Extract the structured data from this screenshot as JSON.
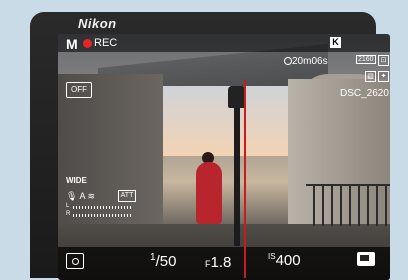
{
  "brand": "Nikon",
  "top_bar": {
    "mode": "M",
    "rec_label": "REC",
    "k_badge": "K"
  },
  "right_info": {
    "remaining_time": "20m06s",
    "frame_size": "2160",
    "counter": "DSC_2620"
  },
  "left_info": {
    "af_off": "OFF",
    "wb": "WIDE",
    "audio_mode": "A",
    "att": "ATT",
    "level_left": "L",
    "level_right": "R"
  },
  "bottom_bar": {
    "shutter_numer": "1",
    "shutter_denom": "50",
    "aperture_prefix": "F",
    "aperture": "1.8",
    "iso_label": "IS",
    "iso_value": "400"
  },
  "colors": {
    "rec_dot": "#e52626",
    "callout_line": "#cc1b1b"
  },
  "icons": {
    "metering": "matrix-metering-icon",
    "monitor": "monitor-mode-icon",
    "timer": "timer-icon",
    "mic": "microphone-icon"
  }
}
